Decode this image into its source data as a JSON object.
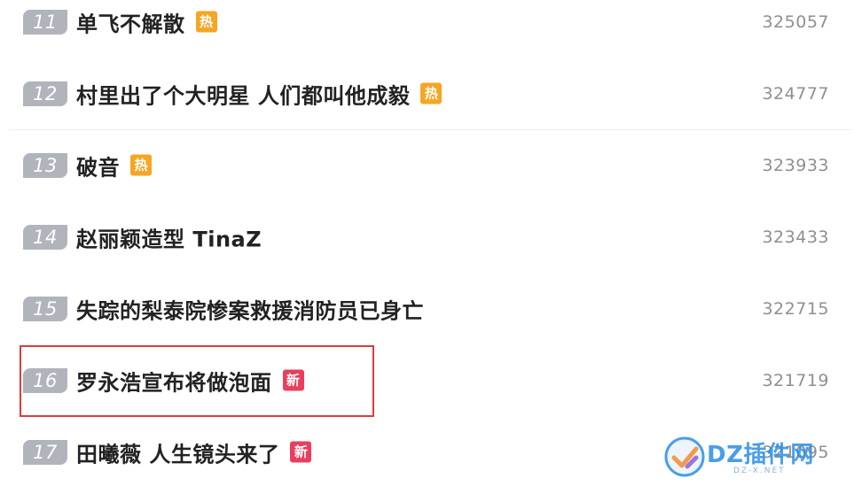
{
  "items": [
    {
      "rank": "11",
      "title": "单飞不解散",
      "badge": "热",
      "badge_type": "hot",
      "count": "325057"
    },
    {
      "rank": "12",
      "title": "村里出了个大明星 人们都叫他成毅",
      "badge": "热",
      "badge_type": "hot",
      "count": "324777"
    },
    {
      "rank": "13",
      "title": "破音",
      "badge": "热",
      "badge_type": "hot",
      "count": "323933"
    },
    {
      "rank": "14",
      "title": "赵丽颖造型 TinaZ",
      "badge": "",
      "badge_type": "",
      "count": "323433"
    },
    {
      "rank": "15",
      "title": "失踪的梨泰院惨案救援消防员已身亡",
      "badge": "",
      "badge_type": "",
      "count": "322715"
    },
    {
      "rank": "16",
      "title": "罗永浩宣布将做泡面",
      "badge": "新",
      "badge_type": "new",
      "count": "321719"
    },
    {
      "rank": "17",
      "title": "田曦薇 人生镜头来了",
      "badge": "新",
      "badge_type": "new",
      "count": "321095"
    }
  ],
  "colors": {
    "rank_bg": "#b2b4bb",
    "hot_badge": "#f5a623",
    "new_badge": "#ea3e5e",
    "highlight_border": "#dc3c3c"
  },
  "watermark": {
    "main": "DZ插件网",
    "sub": "DZ-X.NET",
    "icon": "check-logo-icon"
  }
}
